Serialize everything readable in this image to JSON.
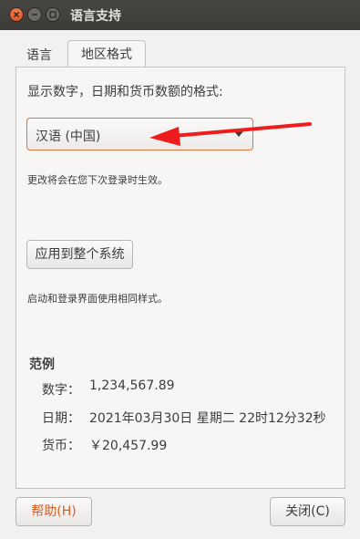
{
  "window": {
    "title": "语言支持"
  },
  "tabs": [
    {
      "label": "语言",
      "active": false
    },
    {
      "label": "地区格式",
      "active": true
    }
  ],
  "region": {
    "format_label": "显示数字，日期和货币数额的格式:",
    "selected_locale": "汉语 (中国)",
    "note_next_login": "更改将会在您下次登录时生效。",
    "apply_button": "应用到整个系统",
    "note_login_screen": "启动和登录界面使用相同样式。"
  },
  "example": {
    "title": "范例",
    "number_label": "数字：",
    "number_value": "1,234,567.89",
    "date_label": "日期：",
    "date_value": "2021年03月30日 星期二 22时12分32秒",
    "currency_label": "货币：",
    "currency_value": "￥20,457.99"
  },
  "buttons": {
    "help": "帮助(H)",
    "close": "关闭(C)"
  },
  "colors": {
    "accent": "#e05723",
    "annotation_arrow": "#ee1c1c"
  }
}
